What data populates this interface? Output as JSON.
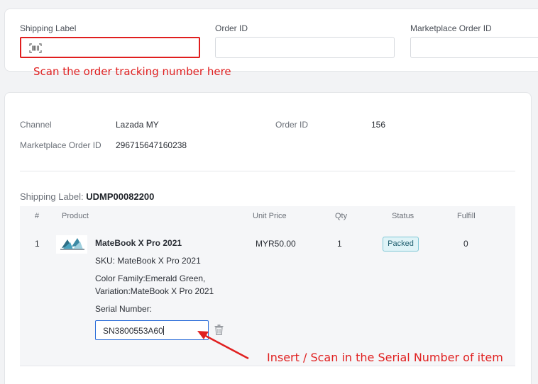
{
  "search": {
    "shipping_label": "Shipping Label",
    "order_id_label": "Order ID",
    "marketplace_order_id_label": "Marketplace Order ID"
  },
  "notes": {
    "scan_tracking": "Scan the order tracking number here",
    "scan_serial": "Insert / Scan in the Serial Number of item"
  },
  "order": {
    "channel_label": "Channel",
    "channel_value": "Lazada MY",
    "order_id_label": "Order ID",
    "order_id_value": "156",
    "marketplace_order_id_label": "Marketplace Order ID",
    "marketplace_order_id_value": "296715647160238",
    "shipping_label_prefix": "Shipping Label:",
    "shipping_label_value": "UDMP00082200"
  },
  "table": {
    "headers": [
      "#",
      "Product",
      "Unit Price",
      "Qty",
      "Status",
      "Fulfill"
    ],
    "rows": [
      {
        "index": "1",
        "product_name": "MateBook X Pro 2021",
        "sku": "SKU: MateBook X Pro 2021",
        "variant_line1": "Color Family:Emerald Green,",
        "variant_line2": "Variation:MateBook X Pro 2021",
        "serial_label": "Serial Number:",
        "serial_value": "SN3800553A60",
        "unit_price": "MYR50.00",
        "qty": "1",
        "status": "Packed",
        "fulfill": "0"
      }
    ]
  },
  "icons": {
    "barcode": "barcode-icon",
    "trash": "trash-icon",
    "product": "product-thumbnail"
  },
  "colors": {
    "annotation_red": "#e02020",
    "active_input_blue": "#2a6dd9",
    "status_badge_bg": "#dff3f7"
  }
}
